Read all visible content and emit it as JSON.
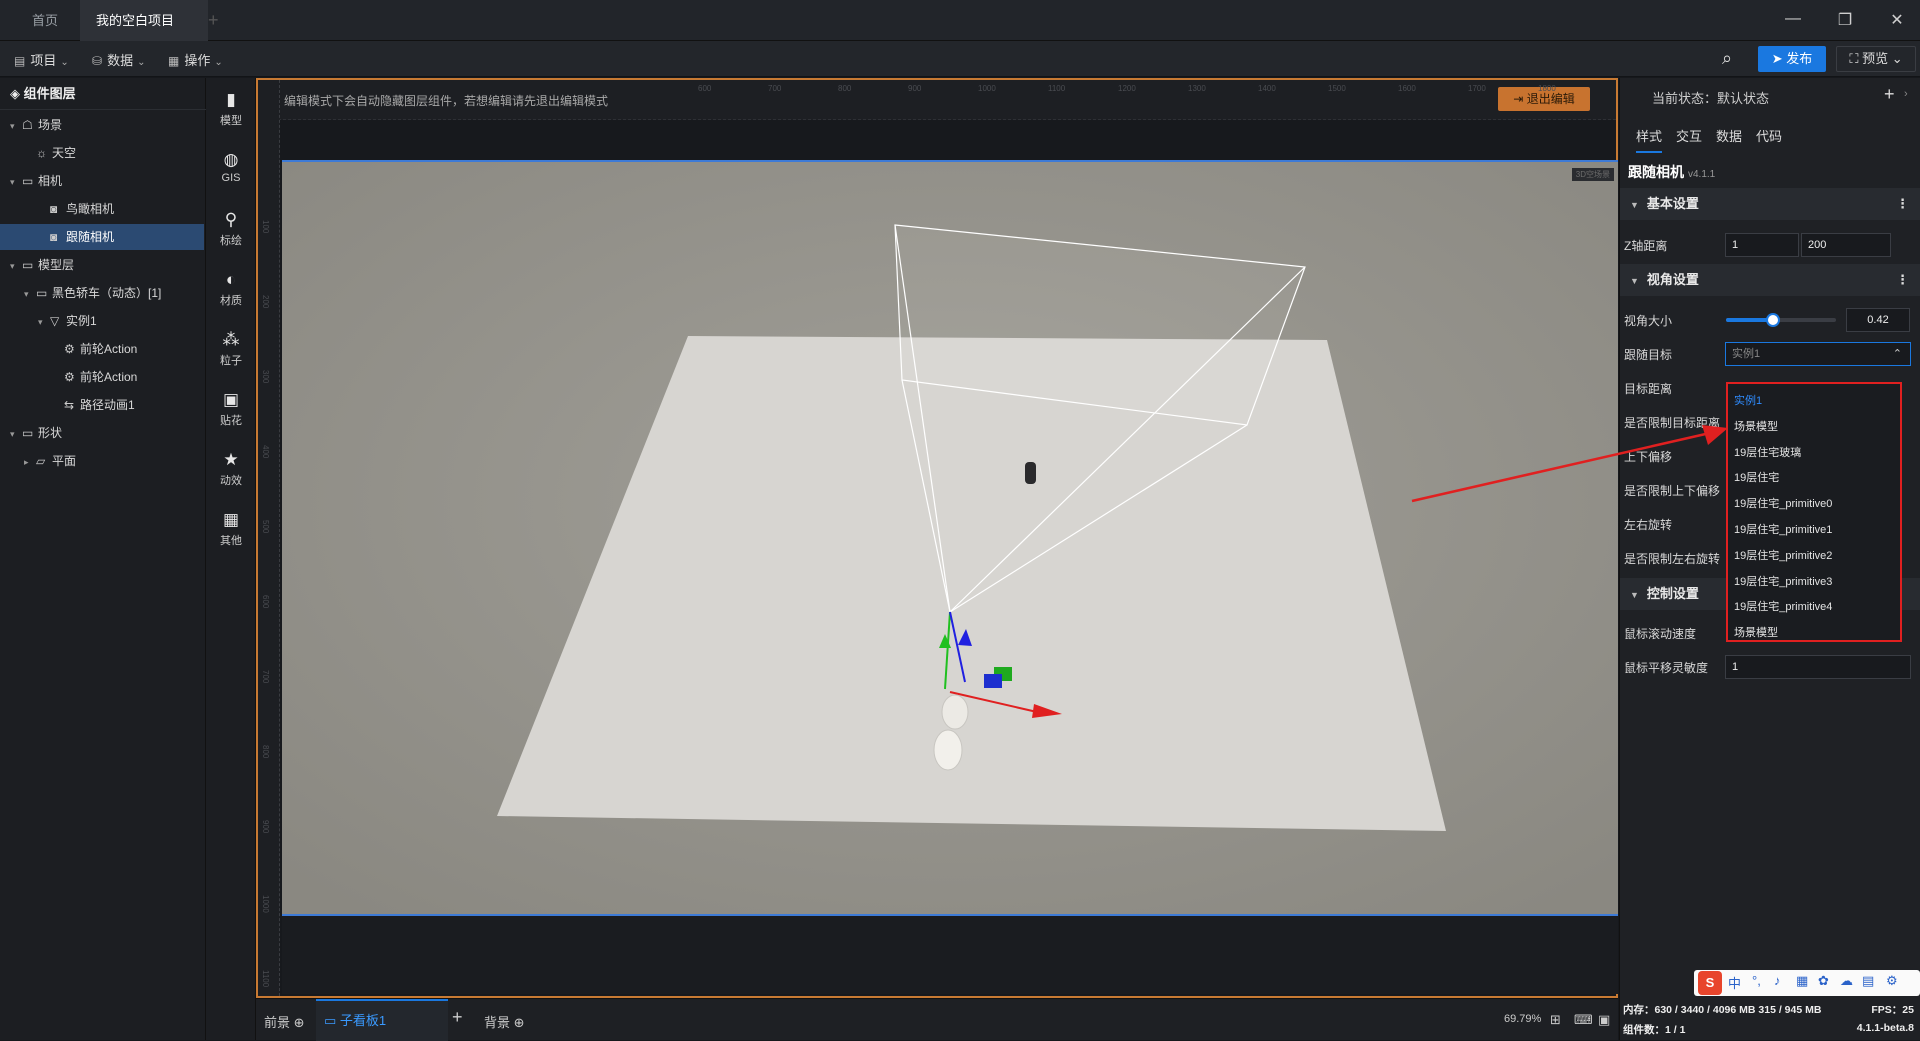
{
  "tabs": {
    "home": "首页",
    "project": "我的空白项目"
  },
  "toolbar": {
    "project": "项目",
    "data": "数据",
    "operate": "操作",
    "publish": "发布",
    "preview": "预览"
  },
  "layers": {
    "title": "组件图层",
    "items": [
      {
        "label": "场景",
        "level": 0,
        "arrow": "▾",
        "icon": "☖"
      },
      {
        "label": "天空",
        "level": 1,
        "arrow": "",
        "icon": "☼"
      },
      {
        "label": "相机",
        "level": 0,
        "arrow": "▾",
        "icon": "▭"
      },
      {
        "label": "鸟瞰相机",
        "level": 2,
        "arrow": "",
        "icon": "◙"
      },
      {
        "label": "跟随相机",
        "level": 2,
        "arrow": "",
        "icon": "◙",
        "selected": true
      },
      {
        "label": "模型层",
        "level": 0,
        "arrow": "▾",
        "icon": "▭"
      },
      {
        "label": "黑色轿车（动态）[1]",
        "level": 1,
        "arrow": "▾",
        "icon": "▭"
      },
      {
        "label": "实例1",
        "level": 2,
        "arrow": "▾",
        "icon": "▽"
      },
      {
        "label": "前轮Action",
        "level": 3,
        "arrow": "",
        "icon": "⚙"
      },
      {
        "label": "前轮Action",
        "level": 3,
        "arrow": "",
        "icon": "⚙"
      },
      {
        "label": "路径动画1",
        "level": 3,
        "arrow": "",
        "icon": "⇆"
      },
      {
        "label": "形状",
        "level": 0,
        "arrow": "▾",
        "icon": "▭"
      },
      {
        "label": "平面",
        "level": 1,
        "arrow": "▸",
        "icon": "▱"
      }
    ]
  },
  "tools": [
    "模型",
    "GIS",
    "标绘",
    "材质",
    "粒子",
    "贴花",
    "动效",
    "其他"
  ],
  "tool_icons": [
    "▮",
    "◍",
    "⚲",
    "◐",
    "⁂",
    "▣",
    "★",
    "▦"
  ],
  "canvas": {
    "hint": "编辑模式下会自动隐藏图层组件，若想编辑请先退出编辑模式",
    "exit_edit": "退出编辑",
    "scene_badge": "3D空场景",
    "ruler_top": [
      "600",
      "700",
      "800",
      "900",
      "1000",
      "1100",
      "1200",
      "1300",
      "1400",
      "1500",
      "1600",
      "1700",
      "1800"
    ],
    "ruler_left": [
      "100",
      "200",
      "300",
      "400",
      "500",
      "600",
      "700",
      "800",
      "900",
      "1000",
      "1100"
    ]
  },
  "bottom": {
    "front": "前景",
    "board": "子看板1",
    "back": "背景",
    "zoom": "69.79%"
  },
  "right": {
    "status": "当前状态：默认状态",
    "tabs": [
      "样式",
      "交互",
      "数据",
      "代码"
    ],
    "component": "跟随相机",
    "version": "v4.1.1",
    "basic": "基本设置",
    "z_label": "Z轴距离",
    "z_min": "1",
    "z_max": "200",
    "view": "视角设置",
    "fov_label": "视角大小",
    "fov_value": "0.42",
    "fov_fraction": 0.42,
    "target_label": "跟随目标",
    "target_value": "实例1",
    "labels": [
      "目标距离",
      "是否限制目标距离",
      "上下偏移",
      "是否限制上下偏移",
      "左右旋转",
      "是否限制左右旋转"
    ],
    "control": "控制设置",
    "scroll_speed": "鼠标滚动速度",
    "pan_label": "鼠标平移灵敏度",
    "pan_value": "1"
  },
  "dropdown_options": [
    "实例1",
    "场景模型",
    "19层住宅玻璃",
    "19层住宅",
    "19层住宅_primitive0",
    "19层住宅_primitive1",
    "19层住宅_primitive2",
    "19层住宅_primitive3",
    "19层住宅_primitive4",
    "场景模型"
  ],
  "statusbar": {
    "memory": "内存：630 / 3440 / 4096 MB  315 / 945 MB",
    "fps": "FPS：25",
    "components": "组件数：1 / 1",
    "version": "4.1.1-beta.8"
  },
  "ime": {
    "logo": "S",
    "lang": "中"
  },
  "colors": {
    "accent": "#1a78e0",
    "orange": "#c8732f",
    "annotation": "#e02020"
  }
}
